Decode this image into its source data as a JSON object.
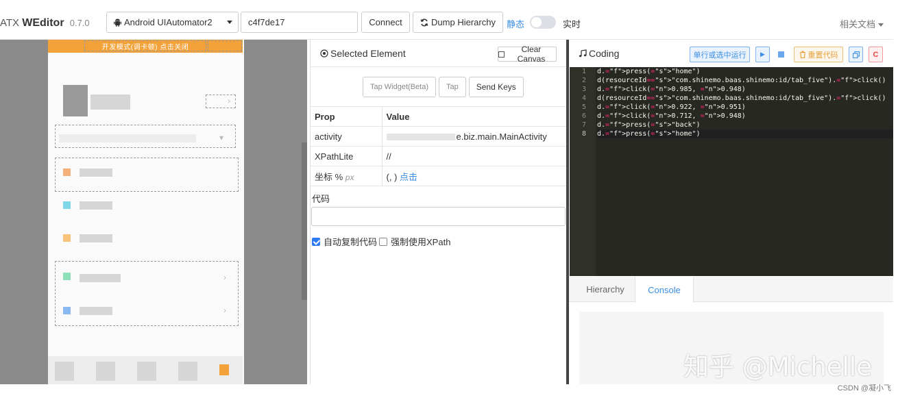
{
  "header": {
    "brand_prefix": "ATX",
    "brand_name": "WEditor",
    "version": "0.7.0",
    "platform_selected": "Android UIAutomator2",
    "device_serial": "c4f7de17",
    "connect_label": "Connect",
    "dump_label": "Dump Hierarchy",
    "mode_static": "静态",
    "mode_realtime": "实时",
    "docs_label": "相关文档"
  },
  "device": {
    "banner_text": "开发模式(调卡顿)   点击关闭"
  },
  "selected": {
    "title": "Selected Element",
    "clear_label": "Clear Canvas",
    "buttons": {
      "tap_widget": "Tap Widget(Beta)",
      "tap": "Tap",
      "send_keys": "Send Keys"
    },
    "table": {
      "head_prop": "Prop",
      "head_value": "Value",
      "rows": [
        {
          "key": "activity",
          "value": "e.biz.main.MainActivity"
        },
        {
          "key": "XPathLite",
          "value": "//"
        },
        {
          "key": "坐标 %",
          "unit": "px",
          "value": "(, )",
          "action": "点击"
        }
      ]
    },
    "code_label": "代码",
    "auto_copy_label": "自动复制代码",
    "force_xpath_label": "强制使用XPath"
  },
  "coding": {
    "title": "Coding",
    "run_label": "单行或选中运行",
    "reset_label": "重置代码",
    "tab_hierarchy": "Hierarchy",
    "tab_console": "Console",
    "lines": [
      "d.press(\"home\")",
      "d(resourceId=\"com.shinemo.baas.shinemo:id/tab_five\").click()",
      "d.click(0.985, 0.948)",
      "d(resourceId=\"com.shinemo.baas.shinemo:id/tab_five\").click()",
      "d.click(0.922, 0.951)",
      "d.click(0.712, 0.948)",
      "d.press(\"back\")",
      "d.press(\"home\")"
    ]
  },
  "watermark": {
    "main": "知乎 @Michelle",
    "csdn": "CSDN @凝小飞"
  },
  "colors": {
    "accent": "#3a8ee6",
    "editor_bg": "#272822",
    "banner": "#f3a23a",
    "reset": "#e6a23c"
  }
}
